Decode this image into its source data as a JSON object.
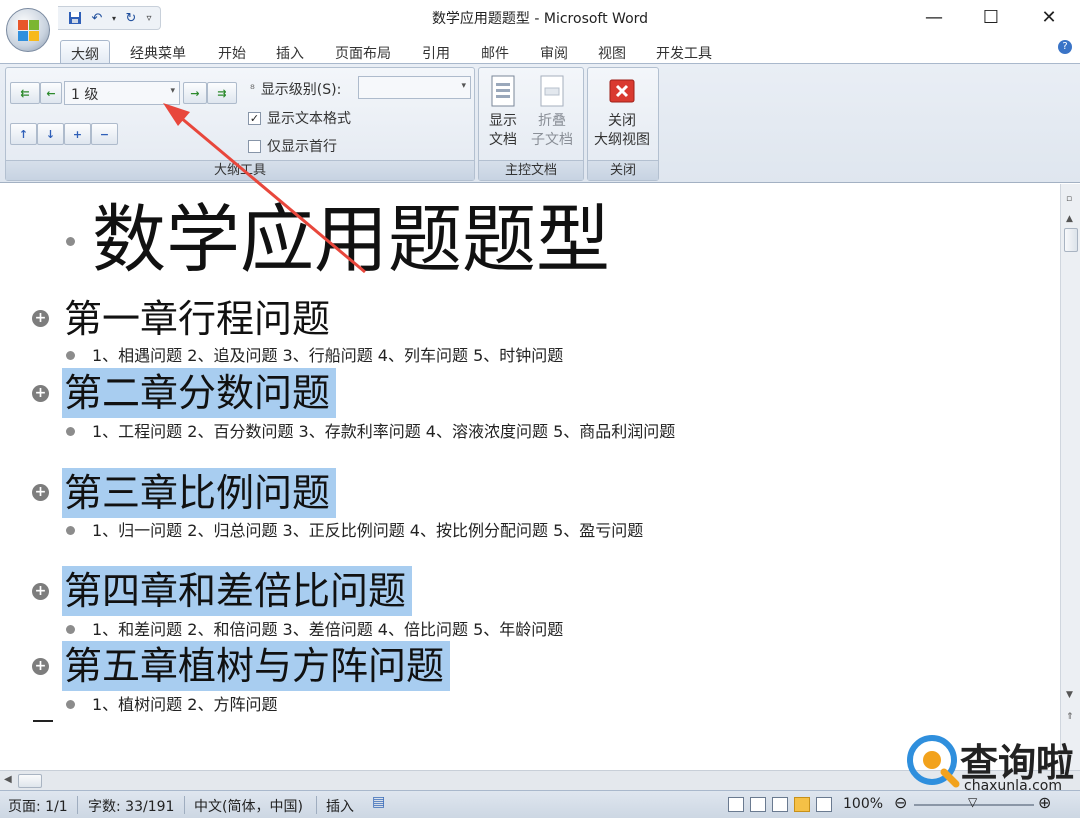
{
  "window": {
    "title": "数学应用题题型 - Microsoft Word",
    "minimize": "—",
    "maximize": "☐",
    "close": "✕"
  },
  "qat": {
    "save_icon": "save-icon",
    "undo_icon": "undo-icon",
    "redo_icon": "redo-icon",
    "customize_icon": "customize-qat-icon"
  },
  "ribbon": {
    "tabs": [
      "大纲",
      "经典菜单",
      "开始",
      "插入",
      "页面布局",
      "引用",
      "邮件",
      "审阅",
      "视图",
      "开发工具"
    ],
    "active_tab": "大纲",
    "outline_tools": {
      "label": "大纲工具",
      "level_value": "1 级",
      "show_level_label": "显示级别(S):",
      "show_level_value": "",
      "show_text_format": "显示文本格式",
      "show_text_format_checked": true,
      "first_line_only": "仅显示首行",
      "first_line_only_checked": false
    },
    "master_doc": {
      "label": "主控文档",
      "show_doc_l1": "显示",
      "show_doc_l2": "文档",
      "collapse_l1": "折叠",
      "collapse_l2": "子文档"
    },
    "close_group": {
      "label": "关闭",
      "close_l1": "关闭",
      "close_l2": "大纲视图"
    }
  },
  "document": {
    "title": "数学应用题题型",
    "chapters": [
      {
        "heading": "第一章行程问题",
        "selected": false,
        "body": "1、相遇问题  2、追及问题  3、行船问题  4、列车问题  5、时钟问题"
      },
      {
        "heading": "第二章分数问题",
        "selected": true,
        "body": "1、工程问题  2、百分数问题  3、存款利率问题  4、溶液浓度问题  5、商品利润问题"
      },
      {
        "heading": "第三章比例问题",
        "selected": true,
        "body": "1、归一问题  2、归总问题  3、正反比例问题  4、按比例分配问题  5、盈亏问题"
      },
      {
        "heading": "第四章和差倍比问题",
        "selected": true,
        "body": "1、和差问题  2、和倍问题  3、差倍问题  4、倍比问题  5、年龄问题"
      },
      {
        "heading": "第五章植树与方阵问题",
        "selected": true,
        "body": "1、植树问题  2、方阵问题"
      }
    ]
  },
  "status": {
    "page": "页面: 1/1",
    "words": "字数: 33/191",
    "language": "中文(简体，中国)",
    "mode": "插入",
    "zoom": "100%"
  },
  "watermark": {
    "text": "查询啦",
    "url": "chaxunla.com"
  },
  "colors": {
    "selection": "#a8cdf0",
    "annotation_arrow": "#e8473c",
    "ribbon_bg": "#e3e9f1"
  }
}
